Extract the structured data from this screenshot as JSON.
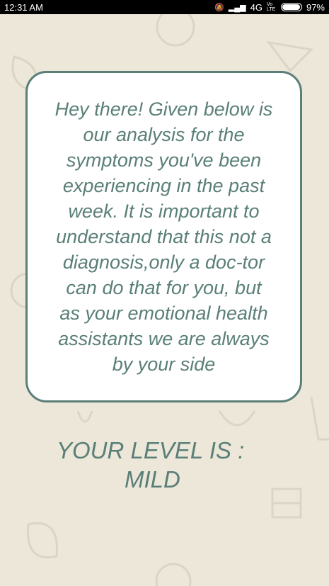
{
  "status_bar": {
    "time": "12:31 AM",
    "network": "4G",
    "volte": "Vo LTE",
    "battery_percent": "97%",
    "battery_level": 0.97
  },
  "message": {
    "text": "Hey there! Given below is our analysis for the symptoms you've been experiencing in the past week. It is important to understand that this not a diagnosis,only a doc-tor can do that for you, but as your emotional health assistants we are always by your side"
  },
  "result": {
    "heading": "YOUR LEVEL IS :",
    "level": "MILD"
  },
  "colors": {
    "accent": "#5a7f78",
    "background": "#ece7d8",
    "card": "#ffffff"
  }
}
